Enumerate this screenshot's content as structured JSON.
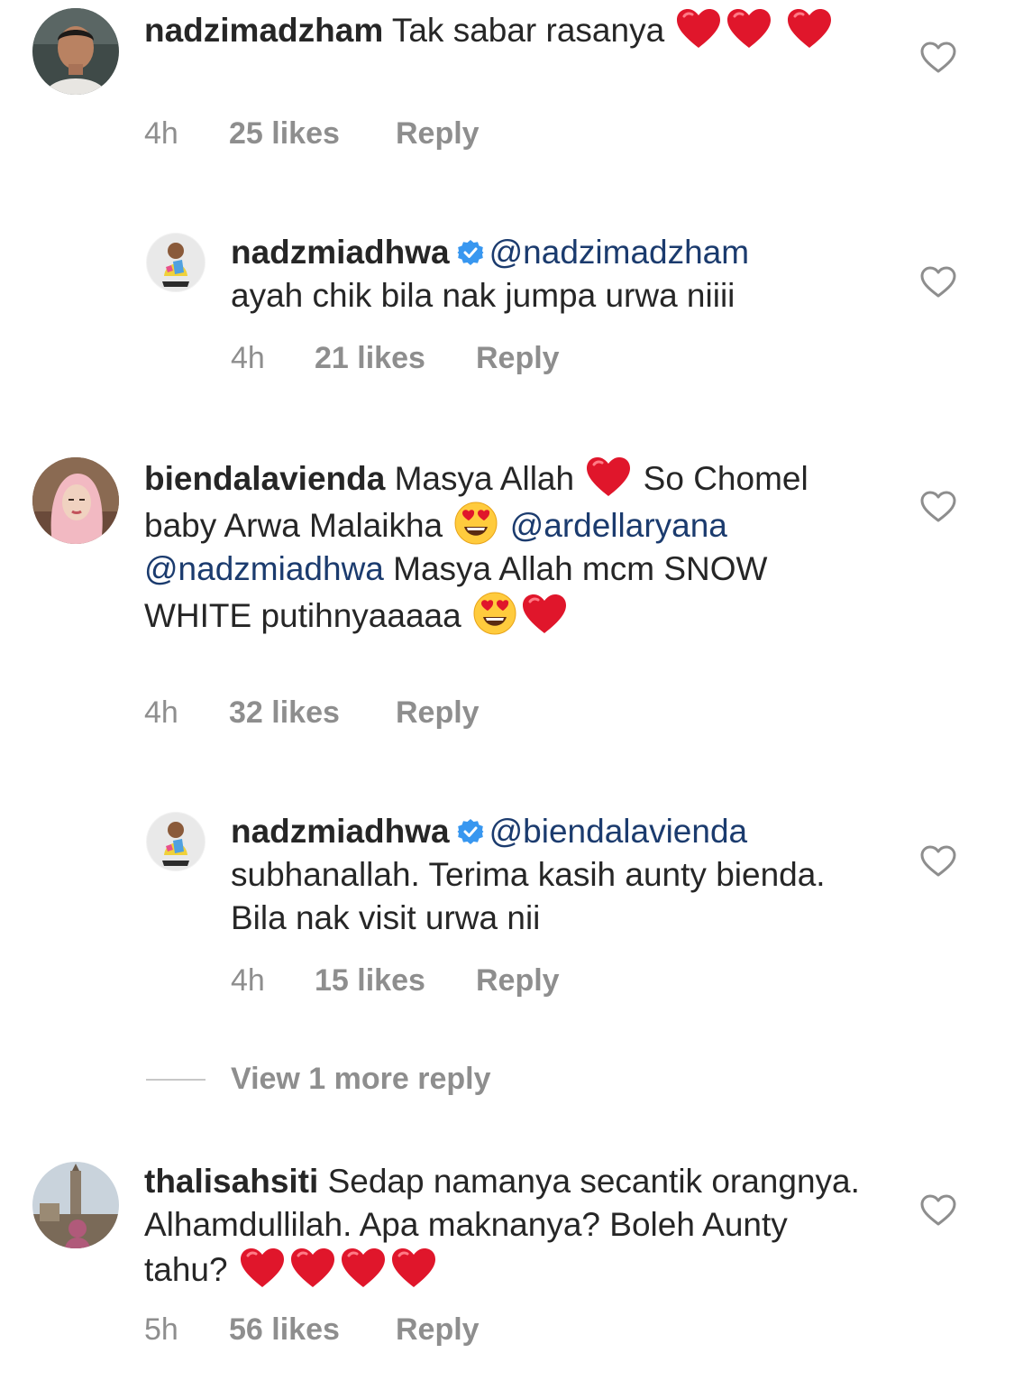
{
  "comments": [
    {
      "username": "nadzimadzham",
      "text": "Tak sabar rasanya",
      "time": "4h",
      "likes": "25 likes",
      "reply_label": "Reply",
      "icons": [
        "heart-emoji",
        "heart-emoji",
        "heart-emoji"
      ]
    },
    {
      "username": "nadzmiadhwa",
      "verified": true,
      "mention": "@nadzimadzham",
      "text": "ayah chik bila nak jumpa urwa niiii",
      "time": "4h",
      "likes": "21 likes",
      "reply_label": "Reply"
    },
    {
      "username": "biendalavienda",
      "text_1": "Masya Allah",
      "text_2": "So Chomel baby Arwa Malaikha",
      "mention_1": "@ardellaryana",
      "mention_2": "@nadzmiadhwa",
      "text_3": "Masya Allah mcm SNOW WHITE putihnyaaaaa",
      "time": "4h",
      "likes": "32 likes",
      "reply_label": "Reply"
    },
    {
      "username": "nadzmiadhwa",
      "verified": true,
      "mention": "@biendalavienda",
      "text": "subhanallah. Terima kasih aunty bienda. Bila nak visit urwa nii",
      "time": "4h",
      "likes": "15 likes",
      "reply_label": "Reply"
    },
    {
      "username": "thalisahsiti",
      "text": "Sedap namanya secantik orangnya. Alhamdullilah. Apa maknanya? Boleh Aunty tahu?",
      "time": "5h",
      "likes": "56 likes",
      "reply_label": "Reply"
    }
  ],
  "view_more_replies": "View 1 more reply",
  "colors": {
    "text": "#262626",
    "meta": "#8e8e8e",
    "mention": "#1b3b6e",
    "verified": "#3897f0",
    "heart_emoji": "#e0162b"
  }
}
